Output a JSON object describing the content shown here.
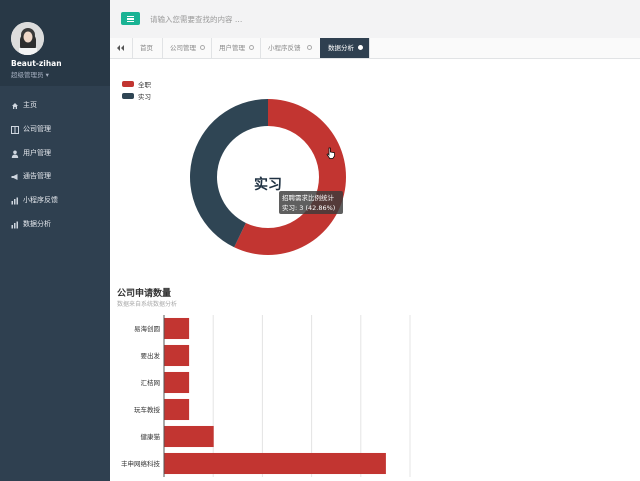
{
  "sidebar": {
    "profile": {
      "name": "Beaut-zihan",
      "role": "超级管理员 ▾"
    },
    "items": [
      {
        "label": "主页",
        "icon": "home-icon"
      },
      {
        "label": "公司管理",
        "icon": "columns-icon"
      },
      {
        "label": "用户管理",
        "icon": "user-icon"
      },
      {
        "label": "通告管理",
        "icon": "bullhorn-icon"
      },
      {
        "label": "小程序反馈",
        "icon": "bar-chart-icon"
      },
      {
        "label": "数据分析",
        "icon": "bar-chart-icon"
      }
    ]
  },
  "topbar": {
    "menu_icon": "hamburger-icon",
    "search_placeholder": "请输入您需要查找的内容 …"
  },
  "tabs": [
    {
      "label": "首页",
      "closable": false,
      "active": false
    },
    {
      "label": "公司管理",
      "closable": true,
      "active": false
    },
    {
      "label": "用户管理",
      "closable": true,
      "active": false
    },
    {
      "label": "小程序反馈",
      "closable": true,
      "active": false
    },
    {
      "label": "数据分析",
      "closable": true,
      "active": true
    }
  ],
  "colors": {
    "sidebar_bg": "#2f4050",
    "accent_green": "#1ab394",
    "series_red": "#c23531",
    "series_navy": "#2f4554"
  },
  "donut": {
    "center_label": "实习",
    "legend": [
      {
        "name": "全职",
        "color": "#c23531"
      },
      {
        "name": "实习",
        "color": "#2f4554"
      }
    ],
    "tooltip": {
      "title": "招聘需求比例统计",
      "line": "实习: 3 (42.86%)"
    }
  },
  "bar_chart": {
    "title": "公司申请数量",
    "subtitle": "数据来自系统数据分析"
  },
  "chart_data": [
    {
      "type": "pie",
      "categories": [
        "全职",
        "实习"
      ],
      "values": [
        4,
        3
      ],
      "percent": [
        57.14,
        42.86
      ]
    },
    {
      "type": "bar",
      "orientation": "horizontal",
      "title": "公司申请数量",
      "subtitle": "数据来自系统数据分析",
      "categories": [
        "易海创圆",
        "要出发",
        "汇桔网",
        "玩车教授",
        "健康猫",
        "丰申网络科技"
      ],
      "values": [
        1,
        1,
        1,
        1,
        2,
        9
      ],
      "xlim": [
        0,
        10
      ],
      "grid": true
    }
  ]
}
